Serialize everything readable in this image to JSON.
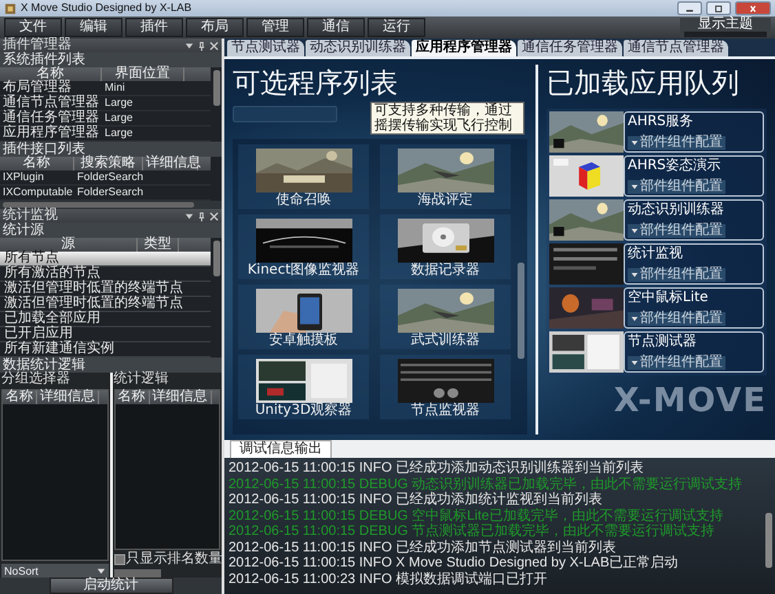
{
  "window": {
    "title": "X Move Studio Designed by X-LAB"
  },
  "menu": [
    "文件",
    "编辑",
    "插件",
    "布局",
    "管理",
    "通信",
    "运行"
  ],
  "theme": {
    "label": "显示主题"
  },
  "plugin_manager": {
    "title": "插件管理器",
    "system_plugins": {
      "title": "系统插件列表",
      "columns": [
        "名称",
        "界面位置"
      ],
      "rows": [
        [
          "布局管理器",
          "Mini"
        ],
        [
          "通信节点管理器",
          "Large"
        ],
        [
          "通信任务管理器",
          "Large"
        ],
        [
          "应用程序管理器",
          "Large"
        ]
      ]
    },
    "plugin_interfaces": {
      "title": "插件接口列表",
      "columns": [
        "名称",
        "搜索策略",
        "详细信息"
      ],
      "rows": [
        [
          "IXPlugin",
          "FolderSearch"
        ],
        [
          "IXComputable",
          "FolderSearch"
        ]
      ]
    }
  },
  "stats_monitor": {
    "title": "统计监视",
    "sources": {
      "title": "统计源",
      "columns": [
        "源",
        "类型"
      ],
      "rows": [
        {
          "name": "所有节点",
          "selected": true
        },
        {
          "name": "所有激活的节点",
          "selected": false
        },
        {
          "name": "激活但管理时低置的终端节点",
          "selected": false
        },
        {
          "name": "激活但管理时低置的终端节点",
          "selected": false
        },
        {
          "name": "已加载全部应用",
          "selected": false
        },
        {
          "name": "已开启应用",
          "selected": false
        },
        {
          "name": "所有新建通信实例",
          "selected": false
        }
      ]
    },
    "logic": {
      "title": "数据统计逻辑",
      "group_selector": {
        "title": "分组选择器",
        "columns": [
          "名称",
          "详细信息"
        ],
        "sort": "NoSort"
      },
      "stat_logic": {
        "title": "统计逻辑",
        "columns": [
          "名称",
          "详细信息"
        ],
        "option": {
          "label": "只显示排名数量",
          "checked": false
        }
      },
      "button": "启动统计"
    }
  },
  "tabs": [
    {
      "label": "节点测试器",
      "selected": false
    },
    {
      "label": "动态识别训练器",
      "selected": false
    },
    {
      "label": "应用程序管理器",
      "selected": true
    },
    {
      "label": "通信任务管理器",
      "selected": false
    },
    {
      "label": "通信节点管理器",
      "selected": false
    }
  ],
  "program_list": {
    "title": "可选程序列表",
    "items": [
      {
        "label": "使命召唤"
      },
      {
        "label": "海战评定"
      },
      {
        "label": "Kinect图像监视器"
      },
      {
        "label": "数据记录器"
      },
      {
        "label": "安卓触摸板"
      },
      {
        "label": "武式训练器"
      },
      {
        "label": "Unity3D观察器"
      },
      {
        "label": "节点监视器"
      }
    ]
  },
  "tooltip": "可支持多种传输，通过摇摆传输实现飞行控制",
  "app_queue": {
    "title": "已加载应用队列",
    "items": [
      {
        "name": "AHRS服务",
        "button": "部件组件配置"
      },
      {
        "name": "AHRS姿态演示",
        "button": "部件组件配置"
      },
      {
        "name": "动态识别训练器",
        "button": "部件组件配置"
      },
      {
        "name": "统计监视",
        "button": "部件组件配置"
      },
      {
        "name": "空中鼠标Lite",
        "button": "部件组件配置"
      },
      {
        "name": "节点测试器",
        "button": "部件组件配置"
      }
    ]
  },
  "logo": "X-MOVE",
  "log": {
    "tab": "调试信息输出",
    "lines": [
      {
        "kind": "info",
        "text": "2012-06-15 11:00:15 INFO 已经成功添加动态识别训练器到当前列表"
      },
      {
        "kind": "debug",
        "text": "2012-06-15 11:00:15 DEBUG 动态识别训练器已加载完毕，由此不需要运行调试支持"
      },
      {
        "kind": "info",
        "text": "2012-06-15 11:00:15 INFO 已经成功添加统计监视到当前列表"
      },
      {
        "kind": "debug",
        "text": "2012-06-15 11:00:15 DEBUG 空中鼠标Lite已加载完毕，由此不需要运行调试支持"
      },
      {
        "kind": "debug",
        "text": "2012-06-15 11:00:15 DEBUG 节点测试器已加载完毕，由此不需要运行调试支持"
      },
      {
        "kind": "info",
        "text": "2012-06-15 11:00:15 INFO 已经成功添加节点测试器到当前列表"
      },
      {
        "kind": "info",
        "text": "2012-06-15 11:00:15 INFO X Move Studio Designed by X-LAB已正常启动"
      },
      {
        "kind": "info",
        "text": "2012-06-15 11:00:23 INFO 模拟数据调试端口已打开"
      }
    ]
  }
}
